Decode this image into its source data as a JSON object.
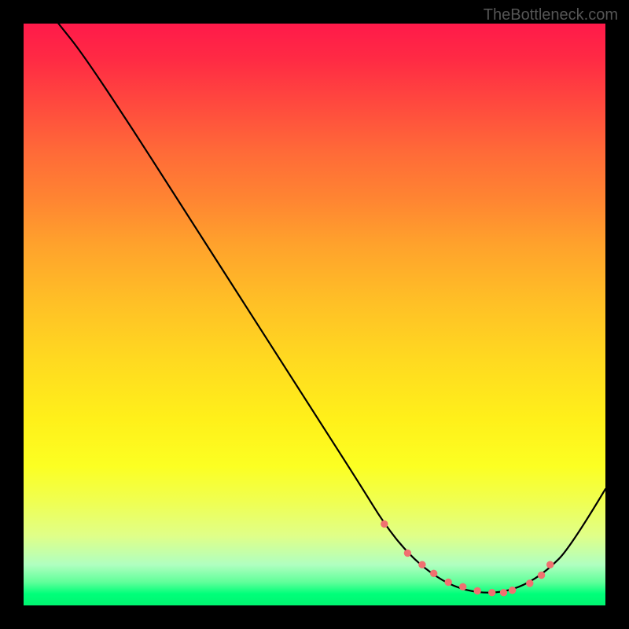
{
  "watermark": "TheBottleneck.com",
  "chart_data": {
    "type": "line",
    "title": "",
    "xlabel": "",
    "ylabel": "",
    "xlim": [
      0,
      100
    ],
    "ylim": [
      0,
      100
    ],
    "series": [
      {
        "name": "curve",
        "x": [
          6,
          10,
          18,
          26,
          34,
          42,
          50,
          58,
          62,
          66,
          70,
          74,
          78,
          82,
          86,
          90,
          94,
          100
        ],
        "values": [
          100,
          95,
          83,
          70.5,
          58,
          45.5,
          33,
          20.5,
          14,
          9,
          5.5,
          3.2,
          2.2,
          2.2,
          3.4,
          6,
          10,
          20
        ]
      }
    ],
    "markers": {
      "name": "highlight-dots",
      "color": "#f07070",
      "x": [
        62,
        66,
        68.5,
        70.5,
        73,
        75.5,
        78,
        80.5,
        82.5,
        84,
        87,
        89,
        90.5
      ],
      "values": [
        14,
        9,
        7,
        5.5,
        4,
        3.2,
        2.5,
        2.2,
        2.2,
        2.6,
        3.8,
        5.2,
        7
      ]
    },
    "gradient_stops": [
      {
        "pos": 0,
        "color": "#ff1a4a"
      },
      {
        "pos": 6,
        "color": "#ff2a44"
      },
      {
        "pos": 14,
        "color": "#ff4a3e"
      },
      {
        "pos": 22,
        "color": "#ff6a38"
      },
      {
        "pos": 30,
        "color": "#ff8432"
      },
      {
        "pos": 38,
        "color": "#ffa22c"
      },
      {
        "pos": 48,
        "color": "#ffc026"
      },
      {
        "pos": 58,
        "color": "#ffda20"
      },
      {
        "pos": 68,
        "color": "#fff01a"
      },
      {
        "pos": 76,
        "color": "#fcff22"
      },
      {
        "pos": 82,
        "color": "#f0ff50"
      },
      {
        "pos": 88,
        "color": "#e0ff88"
      },
      {
        "pos": 93,
        "color": "#b0ffc0"
      },
      {
        "pos": 96,
        "color": "#60ff9a"
      },
      {
        "pos": 98,
        "color": "#00ff7a"
      },
      {
        "pos": 100,
        "color": "#00f570"
      }
    ]
  }
}
